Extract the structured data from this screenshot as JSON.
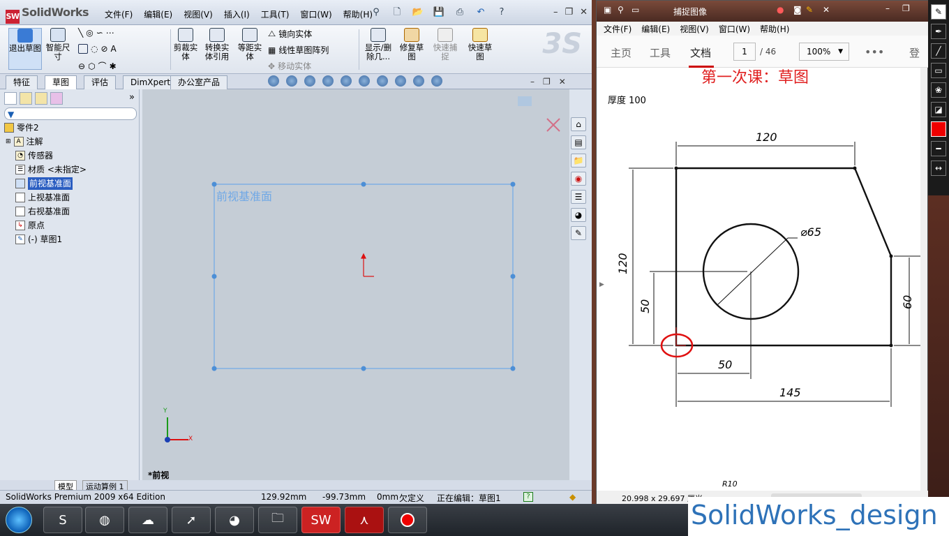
{
  "solidworks": {
    "logo": "SolidWorks",
    "menu": [
      "文件(F)",
      "编辑(E)",
      "视图(V)",
      "插入(I)",
      "工具(T)",
      "窗口(W)",
      "帮助(H)"
    ],
    "ribbon": {
      "exit_sketch": "退出草图",
      "smart_dim": "智能尺寸",
      "trim": "剪裁实体",
      "convert": "转换实体引用",
      "offset": "等距实体",
      "mirror": "镜向实体",
      "linear_pattern": "线性草图阵列",
      "move": "移动实体",
      "show_delete": "显示/删除几...",
      "repair": "修复草图",
      "quick_snap": "快速捕捉",
      "rapid_sketch": "快速草图"
    },
    "tabs": [
      "特征",
      "草图",
      "评估",
      "DimXpert",
      "办公室产品"
    ],
    "selected_tab": "草图",
    "tree": {
      "root": "零件2",
      "items": [
        "注解",
        "传感器",
        "材质 <未指定>",
        "前视基准面",
        "上视基准面",
        "右视基准面",
        "原点",
        "(-) 草图1"
      ],
      "selected": "前视基准面"
    },
    "graphics": {
      "plane_label": "前视基准面",
      "view_label": "*前视",
      "axis_x": "X",
      "axis_y": "Y"
    },
    "bottom_tabs": [
      "模型",
      "运动算例 1"
    ],
    "status": {
      "edition": "SolidWorks Premium 2009 x64 Edition",
      "x": "129.92mm",
      "y": "-99.73mm",
      "z": "0mm",
      "state": "欠定义",
      "editing": "正在编辑：草图1"
    }
  },
  "acrobat": {
    "title": "捕捉图像",
    "menu": [
      "文件(F)",
      "编辑(E)",
      "视图(V)",
      "窗口(W)",
      "帮助(H)"
    ],
    "toolbar": {
      "home": "主页",
      "tools": "工具",
      "document": "文档",
      "page": "1",
      "page_total": "/ 46",
      "zoom": "100%",
      "login": "登"
    },
    "page": {
      "heading": "第一次课：草图",
      "thickness": "厚度 100",
      "dims": {
        "top_width": "120",
        "left_height": "120",
        "hole_height": "50",
        "hole_dia": "⌀65",
        "right_height": "60",
        "hole_x": "50",
        "bottom_width": "145",
        "radius": "R10"
      }
    },
    "status": "20.998 x 29.697 厘米"
  },
  "watermark": "SolidWorks_design"
}
